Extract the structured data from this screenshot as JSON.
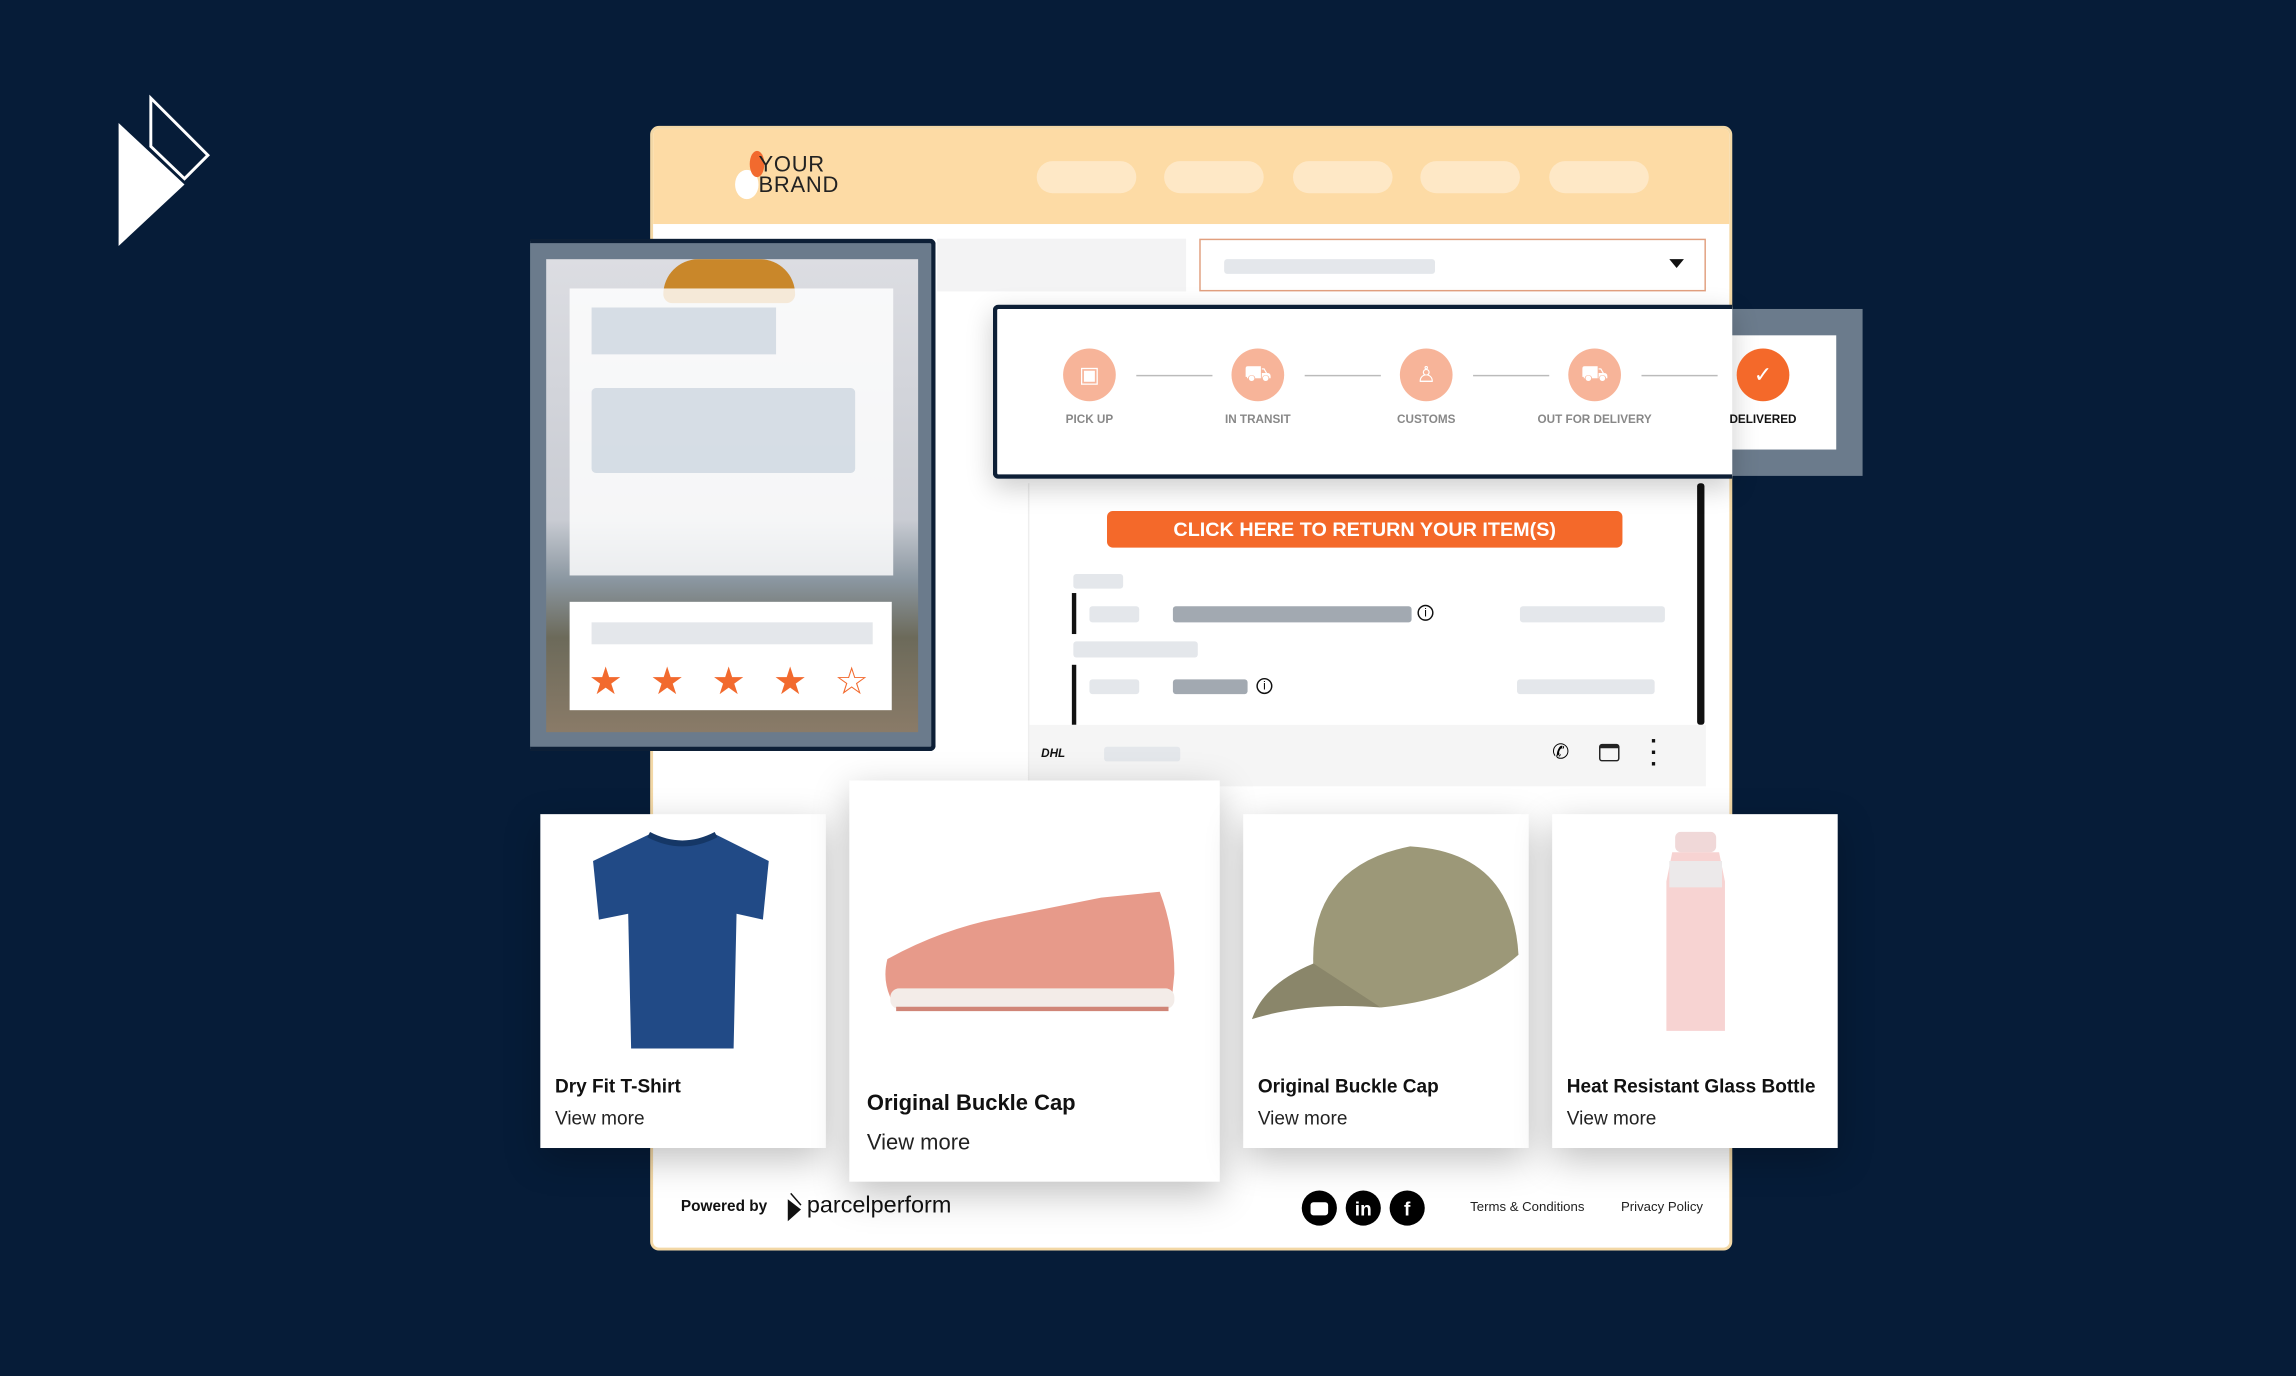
{
  "colors": {
    "background": "#061c38",
    "header": "#fddba5",
    "accent": "#f4692a",
    "step": "#f7b499"
  },
  "brand": {
    "line1": "YOUR",
    "line2": "BRAND"
  },
  "rating": {
    "value": 4,
    "max": 5
  },
  "tracking": {
    "steps": [
      {
        "label": "PICK UP",
        "icon": "package-icon",
        "done": false
      },
      {
        "label": "IN TRANSIT",
        "icon": "truck-icon",
        "done": false
      },
      {
        "label": "CUSTOMS",
        "icon": "officer-icon",
        "done": false
      },
      {
        "label": "OUT FOR DELIVERY",
        "icon": "delivery-truck-icon",
        "done": false
      },
      {
        "label": "DELIVERED",
        "icon": "check-icon",
        "done": true
      }
    ]
  },
  "return_button": "CLICK HERE TO RETURN YOUR ITEM(S)",
  "carrier": "DHL",
  "products": [
    {
      "title": "Dry Fit T-Shirt",
      "link": "View more"
    },
    {
      "title": "Original Buckle Cap",
      "link": "View more"
    },
    {
      "title": "Original Buckle Cap",
      "link": "View more"
    },
    {
      "title": "Heat Resistant Glass Bottle",
      "link": "View more"
    }
  ],
  "footer": {
    "powered_by": "Powered by",
    "logo": "parcelperform",
    "terms": "Terms & Conditions",
    "privacy": "Privacy Policy",
    "social": [
      "youtube-icon",
      "linkedin-icon",
      "facebook-icon"
    ]
  }
}
